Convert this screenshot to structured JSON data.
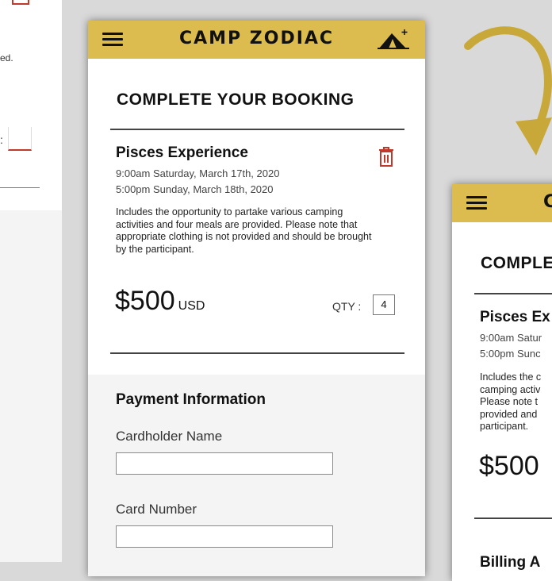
{
  "left_fragment": {
    "text_top": "ed.",
    "colon": ":"
  },
  "phone_main": {
    "brand": "CAMP ZODIAC",
    "heading": "COMPLETE YOUR BOOKING",
    "product": {
      "name": "Pisces Experience",
      "start": "9:00am Saturday, March 17th, 2020",
      "end": "5:00pm Sunday, March 18th, 2020",
      "description": "Includes the opportunity to partake various camping activities and four meals are provided. Please note that appropriate clothing is not provided and should be brought by the participant.",
      "price": "$500",
      "currency": "USD",
      "qty_label": "QTY :",
      "qty_value": "4"
    },
    "payment": {
      "heading": "Payment Information",
      "cardholder_label": "Cardholder Name",
      "card_number_label": "Card Number"
    }
  },
  "phone_second": {
    "brand_partial": "C",
    "heading_partial": "COMPLE",
    "product_partial": "Pisces Ex",
    "start_partial": "9:00am Satur",
    "end_partial": "5:00pm Sunc",
    "desc_lines": [
      "Includes the c",
      "camping activ",
      "Please note t",
      "provided and",
      "participant."
    ],
    "price": "$500",
    "footer_partial": "Billing A"
  },
  "colors": {
    "brand_yellow": "#dcbc4e",
    "accent_red": "#c0392b",
    "arrow_gold": "#c9a83a"
  }
}
